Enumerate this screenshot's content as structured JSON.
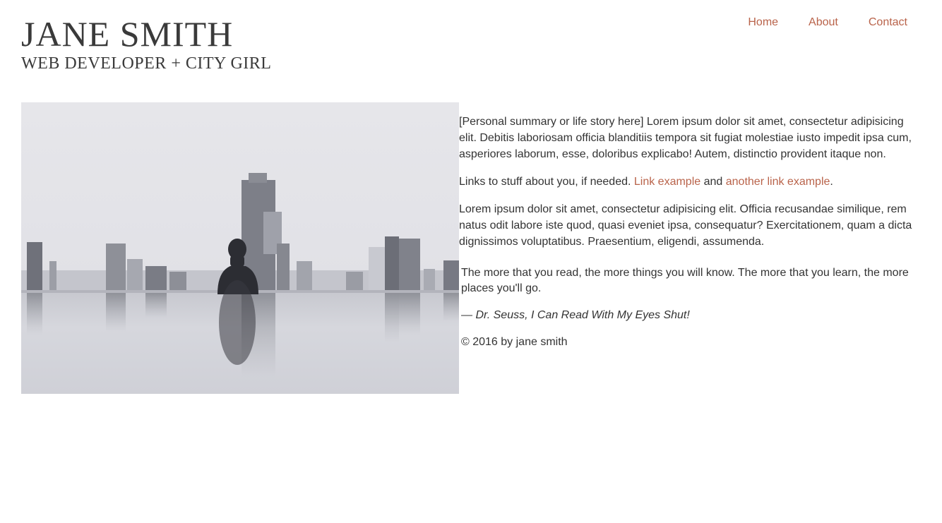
{
  "header": {
    "title": "JANE SMITH",
    "tagline": "WEB DEVELOPER + CITY GIRL"
  },
  "nav": {
    "items": [
      {
        "label": "Home"
      },
      {
        "label": "About"
      },
      {
        "label": "Contact"
      }
    ]
  },
  "main": {
    "photo_icon": "photo-woman-in-infinity-pool-city-skyline",
    "paragraph1": "[Personal summary or life story here] Lorem ipsum dolor sit amet, consectetur adipisicing elit. Debitis laboriosam officia blanditiis tempora sit fugiat molestiae iusto impedit ipsa cum, asperiores laborum, esse, doloribus explicabo! Autem, distinctio provident itaque non.",
    "links_paragraph": {
      "prefix": "Links to stuff about you, if needed. ",
      "link1": "Link example",
      "middle": " and ",
      "link2": "another link example",
      "suffix": "."
    },
    "paragraph3": "Lorem ipsum dolor sit amet, consectetur adipisicing elit. Officia recusandae similique, rem natus odit labore iste quod, quasi eveniet ipsa, consequatur? Exercitationem, quam a dicta dignissimos voluptatibus. Praesentium, eligendi, assumenda.",
    "quote": {
      "text": "The more that you read, the more things you will know. The more that you learn, the more places you'll go.",
      "attribution": "— Dr. Seuss, I Can Read With My Eyes Shut!"
    },
    "copyright": "© 2016 by jane smith"
  },
  "colors": {
    "accent": "#b9634a",
    "text": "#333333",
    "background": "#ffffff"
  }
}
